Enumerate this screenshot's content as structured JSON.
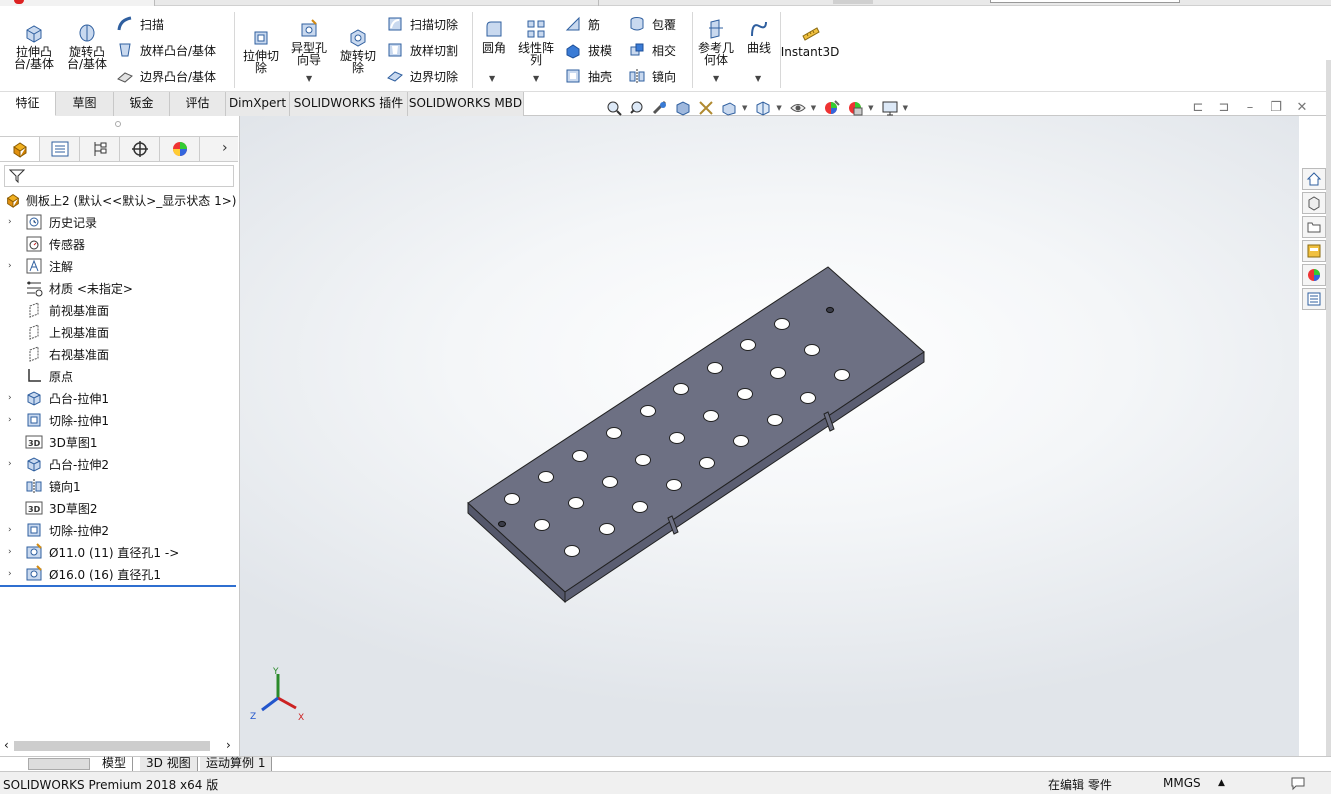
{
  "app": {
    "status_text": "SOLIDWORKS Premium 2018 x64 版"
  },
  "ribbon": {
    "extrude_boss": "拉伸凸\n台/基体",
    "revolve_boss": "旋转凸\n台/基体",
    "sweep": "扫描",
    "loft_boss": "放样凸台/基体",
    "boundary_boss": "边界凸台/基体",
    "extrude_cut": "拉伸切\n除",
    "hole_wizard": "异型孔\n向导",
    "revolve_cut": "旋转切\n除",
    "sweep_cut": "扫描切除",
    "loft_cut": "放样切割",
    "boundary_cut": "边界切除",
    "fillet": "圆角",
    "linear_pattern": "线性阵\n列",
    "rib": "筋",
    "draft": "拔模",
    "shell": "抽壳",
    "wrap": "包覆",
    "intersect": "相交",
    "mirror": "镜向",
    "ref_geometry": "参考几\n何体",
    "curves": "曲线",
    "instant3d": "Instant3D"
  },
  "tabs": [
    "特征",
    "草图",
    "钣金",
    "评估",
    "DimXpert",
    "SOLIDWORKS 插件",
    "SOLIDWORKS MBD"
  ],
  "tree": {
    "root": "侧板上2  (默认<<默认>_显示状态 1>)",
    "items": [
      {
        "label": "历史记录",
        "expand": "›"
      },
      {
        "label": "传感器",
        "expand": ""
      },
      {
        "label": "注解",
        "expand": "›"
      },
      {
        "label": "材质 <未指定>",
        "expand": ""
      },
      {
        "label": "前视基准面",
        "expand": ""
      },
      {
        "label": "上视基准面",
        "expand": ""
      },
      {
        "label": "右视基准面",
        "expand": ""
      },
      {
        "label": "原点",
        "expand": ""
      },
      {
        "label": "凸台-拉伸1",
        "expand": "›"
      },
      {
        "label": "切除-拉伸1",
        "expand": "›"
      },
      {
        "label": "3D草图1",
        "expand": ""
      },
      {
        "label": "凸台-拉伸2",
        "expand": "›"
      },
      {
        "label": "镜向1",
        "expand": ""
      },
      {
        "label": "3D草图2",
        "expand": ""
      },
      {
        "label": "切除-拉伸2",
        "expand": "›"
      },
      {
        "label": "Ø11.0 (11) 直径孔1 ->",
        "expand": "›"
      },
      {
        "label": "Ø16.0 (16) 直径孔1",
        "expand": "›"
      }
    ]
  },
  "triad": {
    "x": "X",
    "y": "Y",
    "z": "Z"
  },
  "bottom_tabs": [
    "模型",
    "3D 视图",
    "运动算例 1"
  ],
  "status": {
    "editing": "在编辑 零件",
    "units": "MMGS",
    "units_arrow": "▲"
  },
  "panel_nav": {
    "left": "‹",
    "right": "›",
    "more": "›"
  },
  "colors": {
    "part": "#6b6e80",
    "part_top": "#6e7184",
    "part_side": "#55586a",
    "accent": "#2f6fd0"
  }
}
